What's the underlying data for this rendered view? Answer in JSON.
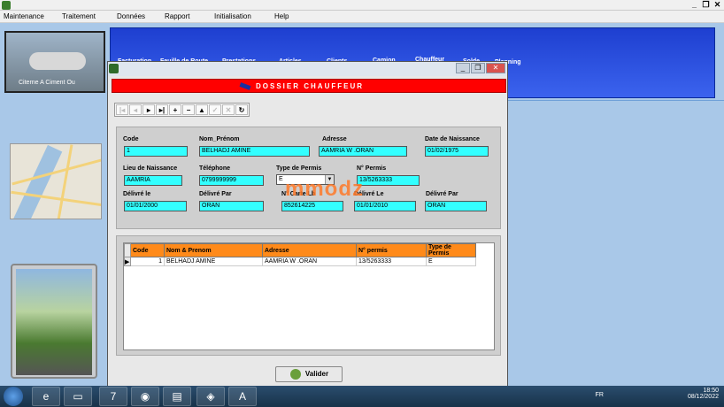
{
  "menu": [
    "Maintenance",
    "Traitement",
    "Données",
    "Rapport",
    "Initialisation",
    "Help"
  ],
  "left": {
    "photo_caption": "Citerne A Ciment Ou"
  },
  "toolband_items": [
    "Facturation",
    "Feuille de Route",
    "Prestations",
    "Articles",
    "Clients",
    "Camion",
    "Chauffeur",
    "Solde",
    "Planning"
  ],
  "dialog": {
    "banner_title": "DOSSIER CHAUFFEUR",
    "nav_buttons": [
      "|◂",
      "◂",
      "▸",
      "▸|",
      "+",
      "−",
      "▲",
      "✓",
      "✕",
      "↻"
    ]
  },
  "form": {
    "code": {
      "label": "Code",
      "value": "1"
    },
    "nom": {
      "label": "Nom_Prénom",
      "value": "BELHADJ AMINE"
    },
    "adresse": {
      "label": "Adresse",
      "value": "AAMRIA W .ORAN"
    },
    "naissance_date": {
      "label": "Date de Naissance",
      "value": "01/02/1975"
    },
    "lieu": {
      "label": "Lieu de Naissance",
      "value": "AAMRIA"
    },
    "telephone": {
      "label": "Téléphone",
      "value": "0799999999"
    },
    "type_permis": {
      "label": "Type de Permis",
      "value": "E"
    },
    "num_permis": {
      "label": "N° Permis",
      "value": "13/5263333"
    },
    "delivre_le": {
      "label": "Délivré le",
      "value": "01/01/2000"
    },
    "delivre_par": {
      "label": "Délivré Par",
      "value": "ORAN"
    },
    "carte": {
      "label": "N° Carte Lb",
      "value": "852614225"
    },
    "delivre_le2": {
      "label": "Délivré Le",
      "value": "01/01/2010"
    },
    "delivre_par2": {
      "label": "Délivré Par",
      "value": "ORAN"
    }
  },
  "grid": {
    "headers": [
      "Code",
      "Nom & Prenom",
      "Adresse",
      "N° permis",
      "Type de Permis"
    ],
    "rows": [
      [
        "1",
        "BELHADJ AMINE",
        "AAMRIA W .ORAN",
        "13/5263333",
        "E"
      ]
    ]
  },
  "valider_label": "Valider",
  "watermark": "mmodz",
  "taskbar": {
    "lang": "FR",
    "time": "18:50",
    "date": "08/12/2022"
  },
  "colors": {
    "banner": "#ff0000",
    "field": "#33ffff",
    "grid_header": "#ff8a1a",
    "toolband": "#2a50e0"
  }
}
